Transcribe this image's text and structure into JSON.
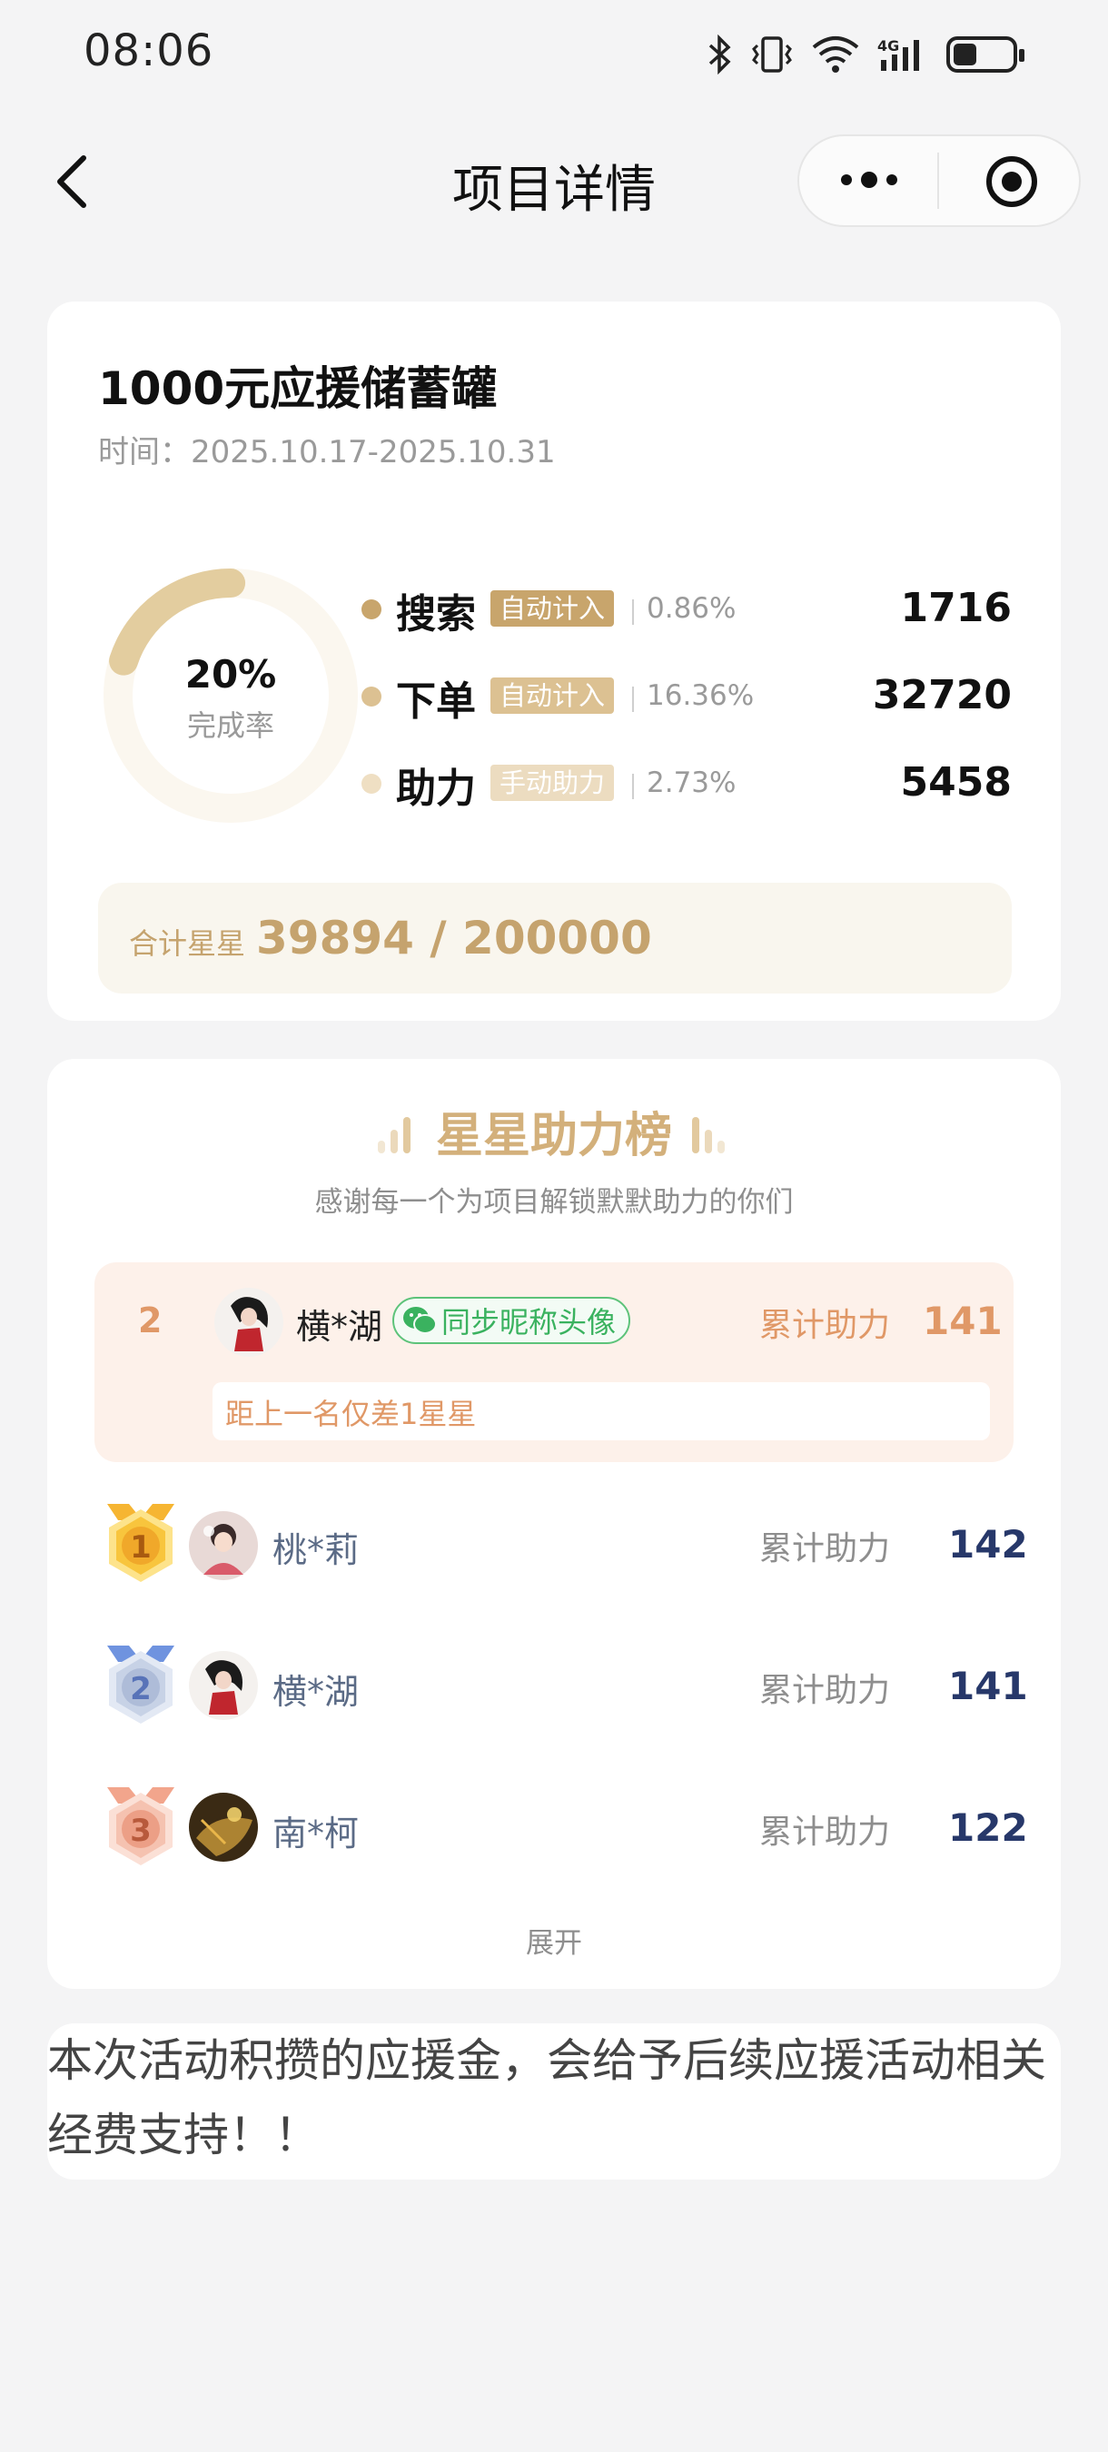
{
  "status_bar": {
    "time": "08:06",
    "icons": [
      "bluetooth-icon",
      "vibrate-icon",
      "wifi-icon",
      "signal-4g-icon",
      "battery-icon"
    ],
    "network": "4G",
    "battery_level": 0.4
  },
  "nav": {
    "title": "项目详情",
    "icons": [
      "back-icon",
      "more-icon",
      "target-icon"
    ]
  },
  "project": {
    "title": "1000元应援储蓄罐",
    "time": "时间：2025.10.17-2025.10.31",
    "completion_pct": "20%",
    "completion_label": "完成率",
    "completion_value": 0.2,
    "metrics": [
      {
        "name": "搜索",
        "tag": "自动计入",
        "pct": "0.86%",
        "value": "1716",
        "color": "#c8a56c",
        "tag_color": "#c8a56c"
      },
      {
        "name": "下单",
        "tag": "自动计入",
        "pct": "16.36%",
        "value": "32720",
        "color": "#dcc192",
        "tag_color": "#dcc192"
      },
      {
        "name": "助力",
        "tag": "手动助力",
        "pct": "2.73%",
        "value": "5458",
        "color": "#efdfc3",
        "tag_color": "#ecdcc0"
      }
    ],
    "total_label": "合计星星",
    "total_value": "39894 / 200000"
  },
  "ranking": {
    "title": "星星助力榜",
    "subtitle": "感谢每一个为项目解锁默默助力的你们",
    "me": {
      "rank": "2",
      "name": "横*湖",
      "sync_label": "同步昵称头像",
      "total_label": "累计助力",
      "total_value": "141",
      "gap_text": "距上一名仅差1星星"
    },
    "rows": [
      {
        "rank": "1",
        "name": "桃*莉",
        "label": "累计助力",
        "value": "142",
        "medal": "gold-medal-icon"
      },
      {
        "rank": "2",
        "name": "横*湖",
        "label": "累计助力",
        "value": "141",
        "medal": "silver-medal-icon"
      },
      {
        "rank": "3",
        "name": "南*柯",
        "label": "累计助力",
        "value": "122",
        "medal": "bronze-medal-icon"
      }
    ],
    "expand_label": "展开"
  },
  "note": "本次活动积攒的应援金，会给予后续应援活动相关经费支持！！",
  "colors": {
    "accent_gold": "#c5a36e",
    "rank_orange": "#e09867",
    "wechat_green": "#3ab25f",
    "value_navy": "#27386a"
  }
}
